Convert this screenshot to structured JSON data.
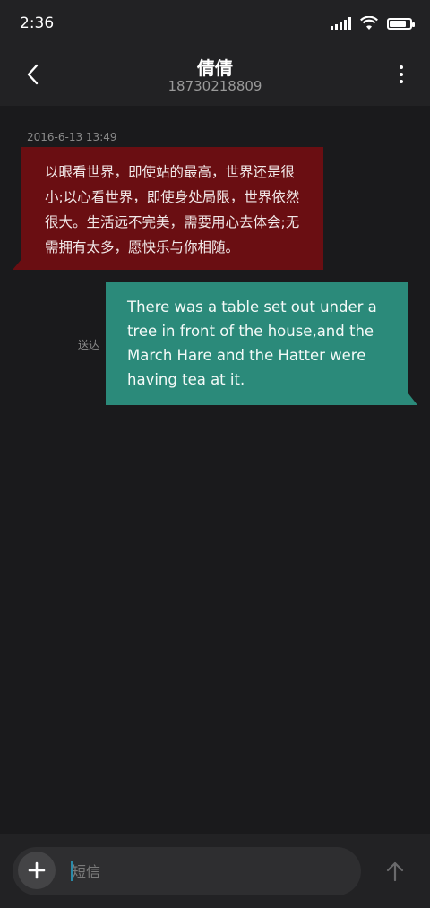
{
  "status_bar": {
    "time": "2:36",
    "icons": [
      "signal-icon",
      "wifi-icon",
      "battery-icon"
    ],
    "battery_level": 0.85
  },
  "header": {
    "contact_name": "倩倩",
    "contact_number": "18730218809",
    "back_icon": "chevron-left-icon",
    "more_icon": "more-vertical-icon"
  },
  "messages": {
    "timestamp": "2016-6-13 13:49",
    "incoming_text": "以眼看世界，即使站的最高，世界还是很小;以心看世界，即使身处局限，世界依然很大。生活远不完美，需要用心去体会;无需拥有太多，愿快乐与你相随。",
    "outgoing_text": "There was a table set out under a tree in front of the house,and the March Hare and the Hatter were having tea at it.",
    "delivered_label": "送达"
  },
  "composer": {
    "placeholder": "短信",
    "add_icon": "plus-icon",
    "send_icon": "arrow-up-icon"
  },
  "colors": {
    "background": "#1a1a1c",
    "bar": "#222224",
    "incoming_bubble": "#6a0e12",
    "outgoing_bubble": "#2b8a7a",
    "cursor": "#2a8aa8"
  }
}
